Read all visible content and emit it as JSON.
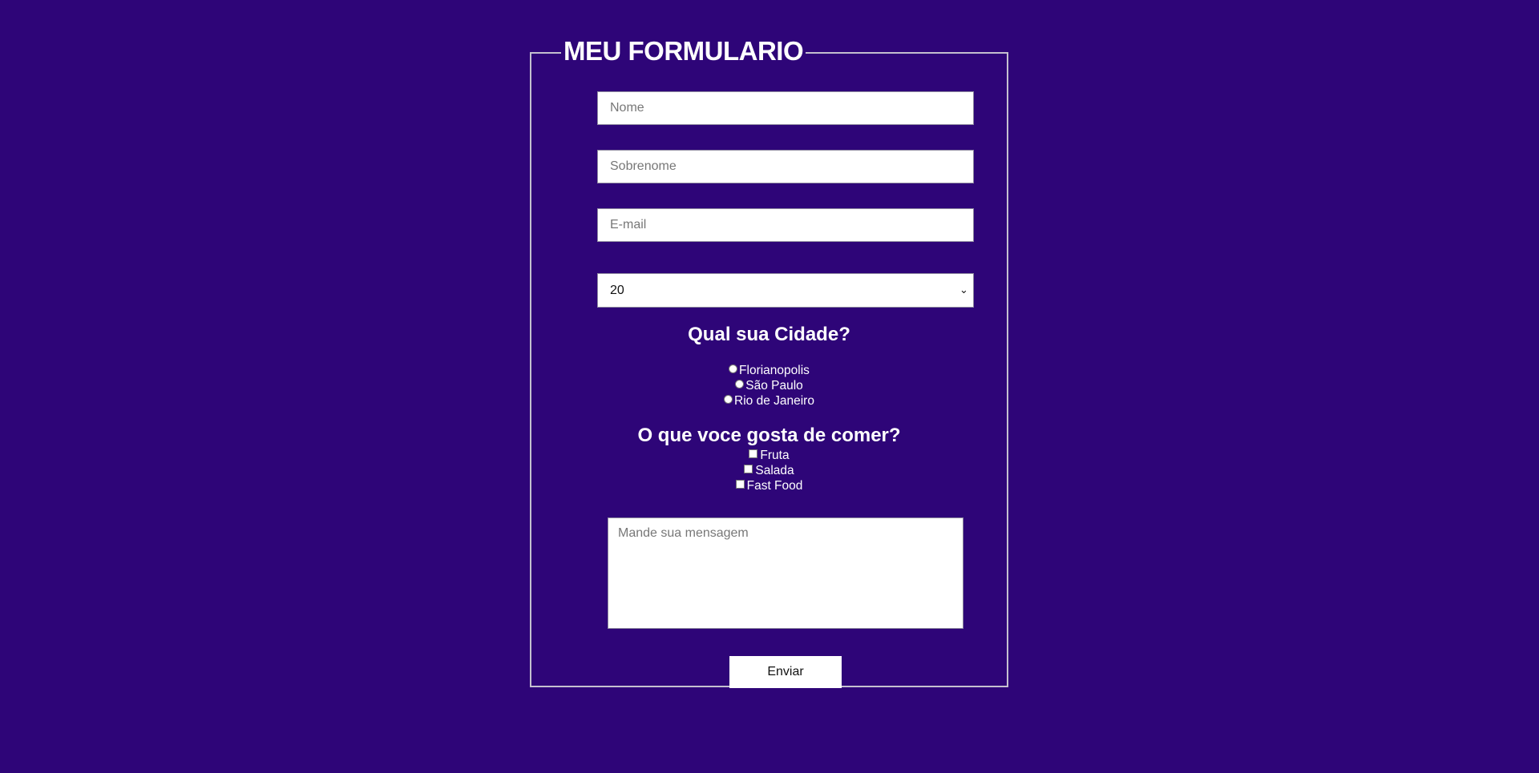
{
  "form": {
    "legend": "MEU FORMULARIO",
    "fields": {
      "nome_placeholder": "Nome",
      "sobrenome_placeholder": "Sobrenome",
      "email_placeholder": "E-mail"
    },
    "age_select": {
      "selected": "20"
    },
    "cidade": {
      "heading": "Qual sua Cidade?",
      "options": [
        "Florianopolis",
        "São Paulo",
        "Rio de Janeiro"
      ]
    },
    "comer": {
      "heading": "O que voce gosta de comer?",
      "options": [
        "Fruta",
        "Salada",
        "Fast Food"
      ]
    },
    "message_placeholder": "Mande sua mensagem",
    "submit_label": "Enviar"
  },
  "icons": {
    "select_arrow": "chevron-down-icon"
  },
  "colors": {
    "background": "#2e0578",
    "text": "#ffffff",
    "border": "#c4c0cf"
  }
}
